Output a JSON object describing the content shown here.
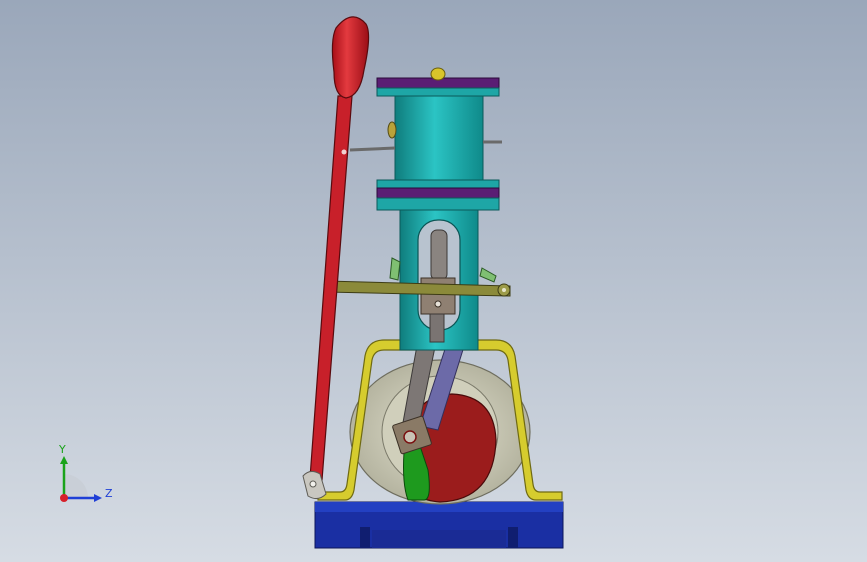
{
  "viewport": {
    "background_top": "#9aa7ba",
    "background_bottom": "#d6dce4"
  },
  "model": {
    "parts": [
      "base-plate",
      "frame",
      "flywheel",
      "crank-disc",
      "connecting-rod",
      "guide-bar",
      "cylinder-housing",
      "cylinder",
      "lever-handle",
      "lever-knob",
      "linkage-arm"
    ],
    "colors": {
      "base": "#1a2fa3",
      "frame": "#d6cc2e",
      "flywheel": "#c9c8b4",
      "crank": "#9b1c1c",
      "crank_hub": "#1e9a1e",
      "rod": "#6c6aa8",
      "cylinder": "#1aa6a6",
      "flange": "#5a1e74",
      "lever": "#c8202a",
      "linkage": "#8b8a3a"
    }
  },
  "triad": {
    "y_label": "Y",
    "z_label": "Z",
    "y_color": "#1aa31a",
    "z_color": "#1f3fd6",
    "x_color": "#d6202a"
  }
}
